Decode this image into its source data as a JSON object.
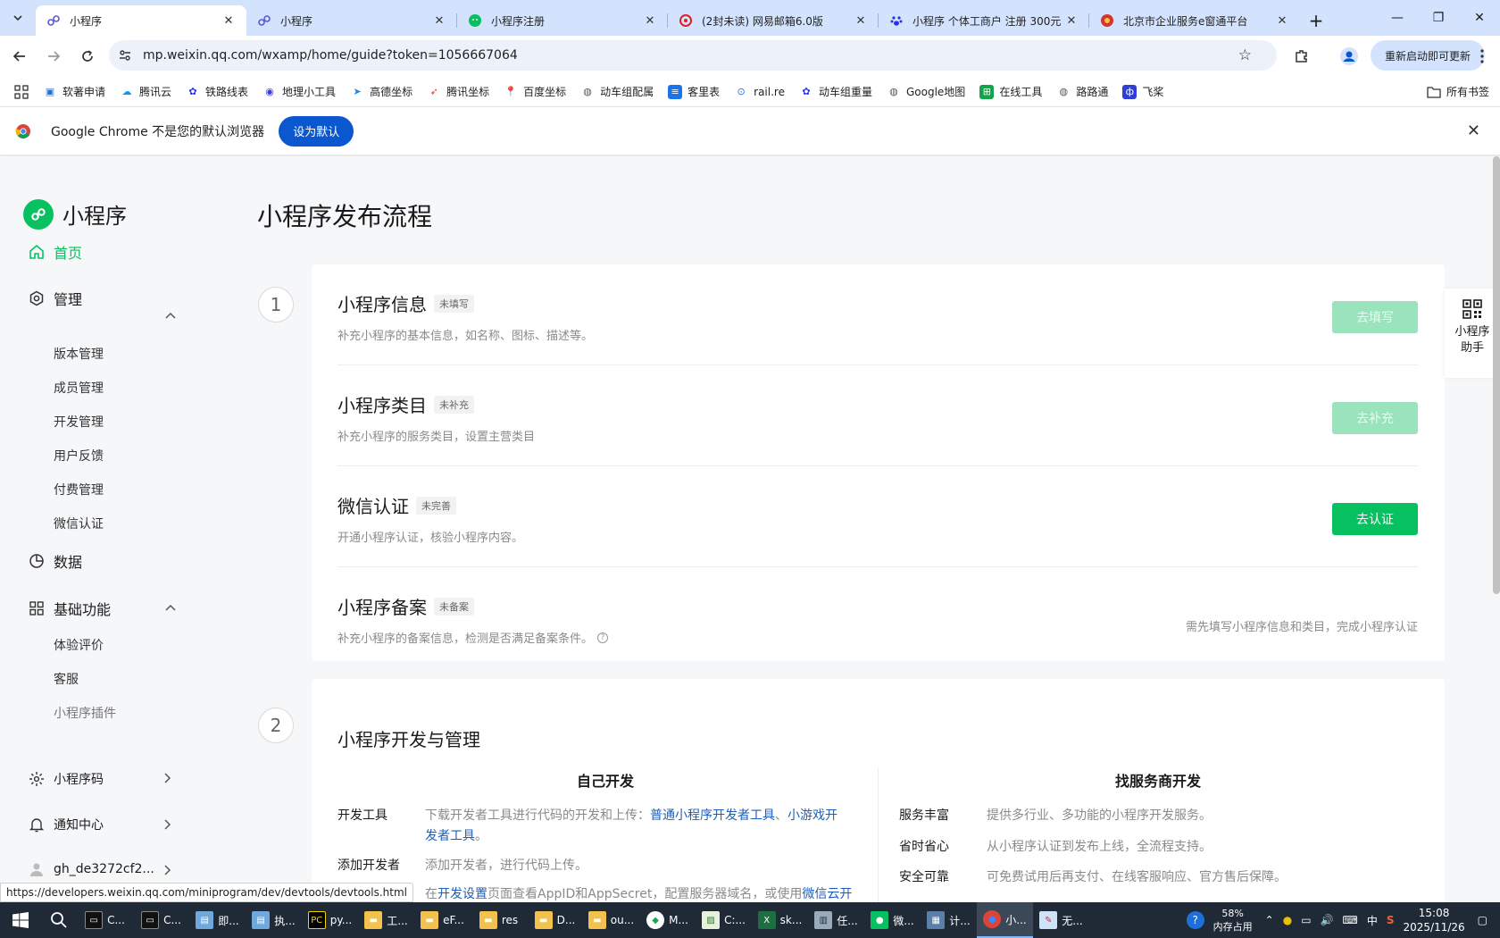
{
  "browser": {
    "tabs": [
      {
        "title": "小程序",
        "active": true
      },
      {
        "title": "小程序",
        "active": false
      },
      {
        "title": "小程序注册",
        "active": false
      },
      {
        "title": "(2封未读) 网易邮箱6.0版",
        "active": false
      },
      {
        "title": "小程序 个体工商户 注册 300元",
        "active": false
      },
      {
        "title": "北京市企业服务e窗通平台",
        "active": false
      }
    ],
    "url": "mp.weixin.qq.com/wxamp/home/guide?token=1056667064",
    "update_button": "重新启动即可更新",
    "bookmarks": [
      "软著申请",
      "腾讯云",
      "铁路线表",
      "地理小工具",
      "高德坐标",
      "腾讯坐标",
      "百度坐标",
      "动车组配属",
      "客里表",
      "rail.re",
      "动车组重量",
      "Google地图",
      "在线工具",
      "路路通",
      "飞桨"
    ],
    "all_bookmarks": "所有书签",
    "infobar": {
      "text": "Google Chrome 不是您的默认浏览器",
      "button": "设为默认"
    },
    "status_url": "https://developers.weixin.qq.com/miniprogram/dev/devtools/devtools.html"
  },
  "sidebar": {
    "logo": "小程序",
    "home": "首页",
    "manage": {
      "label": "管理",
      "items": [
        "版本管理",
        "成员管理",
        "开发管理",
        "用户反馈",
        "付费管理",
        "微信认证"
      ]
    },
    "data": "数据",
    "basic": {
      "label": "基础功能",
      "items": [
        "体验评价",
        "客服",
        "小程序插件"
      ]
    },
    "qrcode": "小程序码",
    "notify": "通知中心",
    "account": "gh_de3272cf2..."
  },
  "main": {
    "title": "小程序发布流程",
    "step1": {
      "number": "1",
      "rows": [
        {
          "title": "小程序信息",
          "badge": "未填写",
          "desc": "补充小程序的基本信息，如名称、图标、描述等。",
          "button": "去填写"
        },
        {
          "title": "小程序类目",
          "badge": "未补充",
          "desc": "补充小程序的服务类目，设置主营类目",
          "button": "去补充"
        },
        {
          "title": "微信认证",
          "badge": "未完善",
          "desc": "开通小程序认证，核验小程序内容。",
          "button": "去认证"
        },
        {
          "title": "小程序备案",
          "badge": "未备案",
          "desc": "补充小程序的备案信息，检测是否满足备案条件。",
          "note": "需先填写小程序信息和类目，完成小程序认证"
        }
      ]
    },
    "step2": {
      "number": "2",
      "title": "小程序开发与管理",
      "self_dev": {
        "heading": "自己开发",
        "devtools_label": "开发工具",
        "devtools_text": "下载开发者工具进行代码的开发和上传：",
        "devtools_link1": "普通小程序开发者工具",
        "devtools_sep": "、",
        "devtools_link2a": "小游戏开",
        "devtools_link2b": "发者工具",
        "devtools_end": "。",
        "adddev_label": "添加开发者",
        "adddev_text": "添加开发者，进行代码上传。",
        "config_text1": "在",
        "config_link": "开发设置",
        "config_text2": "页面查看AppID和AppSecret，配置服务器域名，或使用",
        "config_link2": "微信云开"
      },
      "provider": {
        "heading": "找服务商开发",
        "items": [
          {
            "label": "服务丰富",
            "text": "提供多行业、多功能的小程序开发服务。"
          },
          {
            "label": "省时省心",
            "text": "从小程序认证到发布上线，全流程支持。"
          },
          {
            "label": "安全可靠",
            "text": "可免费试用后再支付、在线客服响应、官方售后保障。"
          }
        ]
      }
    }
  },
  "helper": {
    "line1": "小程序",
    "line2": "助手"
  },
  "taskbar": {
    "apps": [
      "C...",
      "C...",
      "即...",
      "执...",
      "py...",
      "工...",
      "eF...",
      "res",
      "D...",
      "ou...",
      "M...",
      "C:...",
      "sk...",
      "任...",
      "微...",
      "计...",
      "小...",
      "无..."
    ],
    "mem_pct": "58%",
    "mem_label": "内存占用",
    "ime": "中",
    "time": "15:08",
    "date": "2025/11/26"
  },
  "colors": {
    "brand_green": "#07c160",
    "chrome_blue": "#0b57d0",
    "tabbar": "#d3e3fd"
  }
}
